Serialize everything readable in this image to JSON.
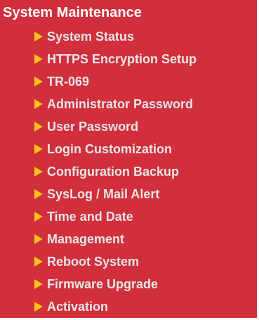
{
  "panel": {
    "title": "System Maintenance",
    "background_color": "#d12f3c",
    "arrow_color": "#f7c21a",
    "items": [
      {
        "label": "System Status",
        "icon": "triangle-right-icon"
      },
      {
        "label": "HTTPS Encryption Setup",
        "icon": "triangle-right-icon"
      },
      {
        "label": "TR-069",
        "icon": "triangle-right-icon"
      },
      {
        "label": "Administrator Password",
        "icon": "triangle-right-icon"
      },
      {
        "label": "User Password",
        "icon": "triangle-right-icon"
      },
      {
        "label": "Login Customization",
        "icon": "triangle-right-icon"
      },
      {
        "label": "Configuration Backup",
        "icon": "triangle-right-icon"
      },
      {
        "label": "SysLog / Mail Alert",
        "icon": "triangle-right-icon"
      },
      {
        "label": "Time and Date",
        "icon": "triangle-right-icon"
      },
      {
        "label": "Management",
        "icon": "triangle-right-icon"
      },
      {
        "label": "Reboot System",
        "icon": "triangle-right-icon"
      },
      {
        "label": "Firmware Upgrade",
        "icon": "triangle-right-icon"
      },
      {
        "label": "Activation",
        "icon": "triangle-right-icon"
      }
    ]
  }
}
